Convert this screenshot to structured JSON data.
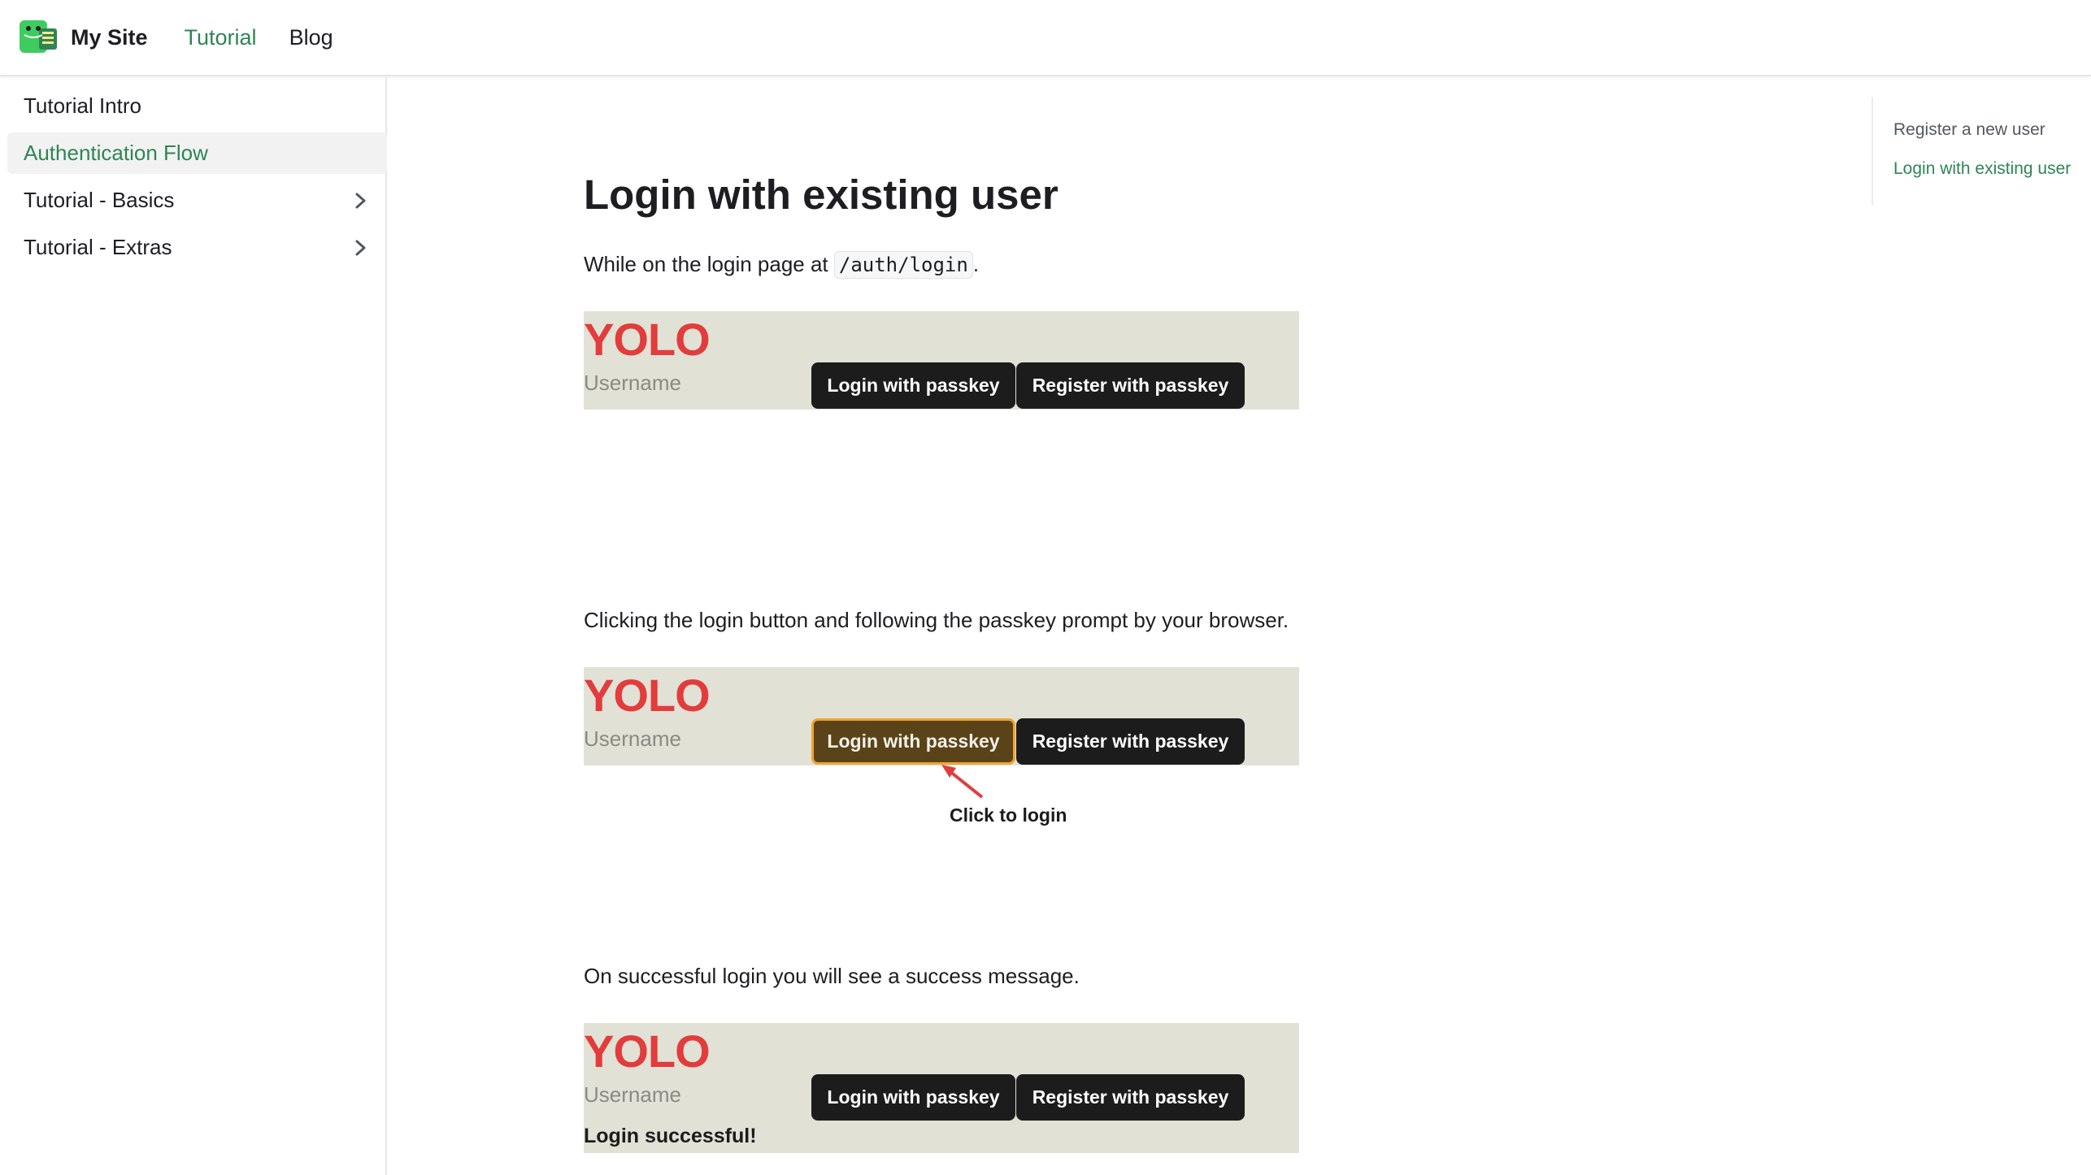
{
  "navbar": {
    "site_title": "My Site",
    "links": [
      "Tutorial",
      "Blog"
    ],
    "active_link": "Tutorial",
    "logo_icon": "dinosaur-logo-icon"
  },
  "sidebar": {
    "items": [
      {
        "label": "Tutorial Intro",
        "expandable": false
      },
      {
        "label": "Authentication Flow",
        "expandable": false,
        "active": true
      },
      {
        "label": "Tutorial - Basics",
        "expandable": true
      },
      {
        "label": "Tutorial - Extras",
        "expandable": true
      }
    ]
  },
  "main": {
    "title": "Login with existing user",
    "intro_prefix": "While on the login page at ",
    "intro_code": "/auth/login",
    "intro_suffix": ".",
    "para_click": "Clicking the login button and following the passkey prompt by your browser.",
    "para_success": "On successful login you will see a success message."
  },
  "screenshot": {
    "brand": "YOLO",
    "username_placeholder": "Username",
    "login_button": "Login with passkey",
    "register_button": "Register with passkey",
    "annotation": "Click to login",
    "success_message": "Login successful!"
  },
  "toc": {
    "items": [
      "Register a new user",
      "Login with existing user"
    ],
    "active_item": "Login with existing user"
  },
  "colors": {
    "accent": "#2e8555",
    "brand_red": "#e23c3c",
    "screenshot_bg": "#e2e1d6",
    "button_dark": "#1c1c1c",
    "highlight_orange": "#f0a330"
  }
}
